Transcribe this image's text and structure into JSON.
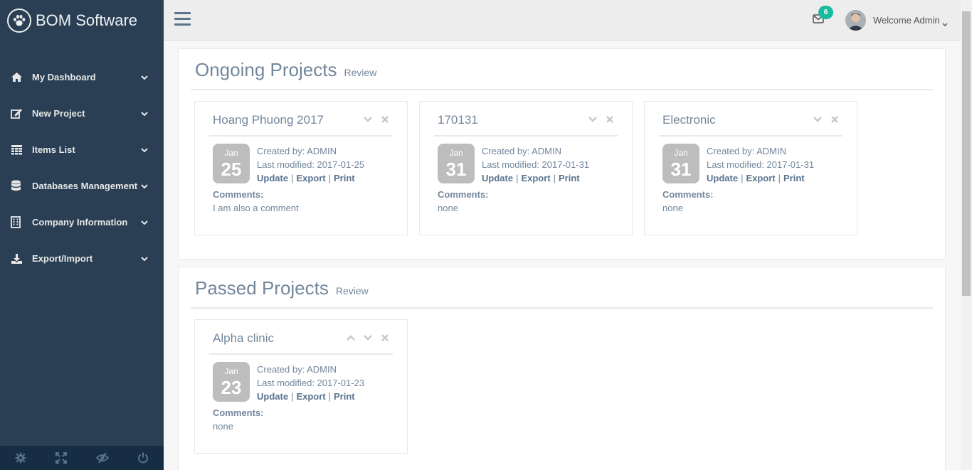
{
  "brand": {
    "title": "BOM Software"
  },
  "sidebar": {
    "items": [
      {
        "label": "My Dashboard",
        "icon": "home-icon"
      },
      {
        "label": "New Project",
        "icon": "edit-icon"
      },
      {
        "label": "Items List",
        "icon": "table-icon"
      },
      {
        "label": "Databases Management",
        "icon": "database-icon"
      },
      {
        "label": "Company Information",
        "icon": "building-icon"
      },
      {
        "label": "Export/Import",
        "icon": "download-icon"
      }
    ],
    "footer": [
      "settings-icon",
      "fullscreen-icon",
      "eye-slash-icon",
      "power-icon"
    ]
  },
  "topnav": {
    "mail_badge": "6",
    "welcome": "Welcome Admin"
  },
  "ongoing": {
    "title": "Ongoing Projects",
    "subtitle": "Review",
    "cards": [
      {
        "name": "Hoang Phuong 2017",
        "month": "Jan",
        "day": "25",
        "created": "Created by: ADMIN",
        "modified": "Last modified: 2017-01-25",
        "comments_label": "Comments:",
        "comment": "I am also a comment"
      },
      {
        "name": "170131",
        "month": "Jan",
        "day": "31",
        "created": "Created by: ADMIN",
        "modified": "Last modified: 2017-01-31",
        "comments_label": "Comments:",
        "comment": "none"
      },
      {
        "name": "Electronic",
        "month": "Jan",
        "day": "31",
        "created": "Created by: ADMIN",
        "modified": "Last modified: 2017-01-31",
        "comments_label": "Comments:",
        "comment": "none"
      }
    ]
  },
  "passed": {
    "title": "Passed Projects",
    "subtitle": "Review",
    "cards": [
      {
        "name": "Alpha clinic",
        "month": "Jan",
        "day": "23",
        "created": "Created by: ADMIN",
        "modified": "Last modified: 2017-01-23",
        "comments_label": "Comments:",
        "comment": "none"
      }
    ]
  },
  "actions": {
    "update": "Update",
    "export": "Export",
    "print": "Print",
    "separator": "|"
  },
  "colors": {
    "sidebar": "#2a3f54",
    "footer": "#172d44",
    "badge": "#1abb9c",
    "text": "#73879c",
    "date_tile": "#bdbdbd"
  }
}
